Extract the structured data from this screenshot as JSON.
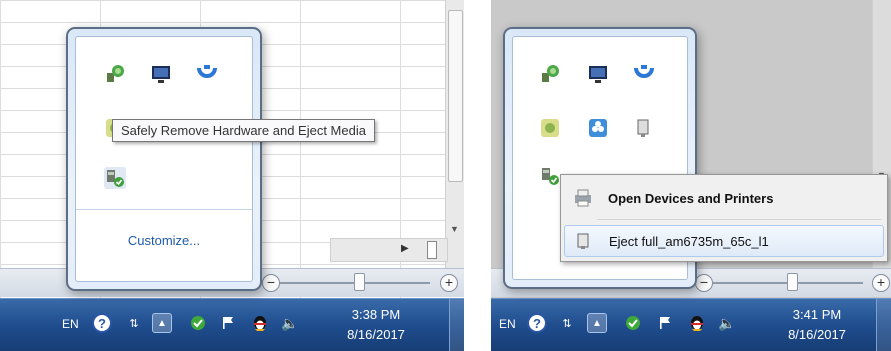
{
  "left": {
    "tooltip": "Safely Remove Hardware and Eject Media",
    "customize_label": "Customize...",
    "taskbar": {
      "lang": "EN",
      "time": "3:38 PM",
      "date": "8/16/2017"
    },
    "icons": [
      "network-icon",
      "display-monitor-icon",
      "bluetooth-icon",
      "update-icon",
      "blue-app-icon",
      "usb-device-icon",
      "safely-remove-hardware-icon"
    ]
  },
  "right": {
    "menu": {
      "item_open": "Open Devices and Printers",
      "item_eject": "Eject full_am6735m_65c_l1"
    },
    "taskbar": {
      "lang": "EN",
      "time": "3:41 PM",
      "date": "8/16/2017"
    },
    "icons": [
      "network-icon",
      "display-monitor-icon",
      "bluetooth-icon",
      "update-icon",
      "blue-app-icon",
      "usb-device-icon",
      "safely-remove-hardware-icon"
    ]
  },
  "colors": {
    "taskbar": "#1f4d8e",
    "link": "#1f5aa8",
    "flyout_border": "#5c6e85"
  }
}
